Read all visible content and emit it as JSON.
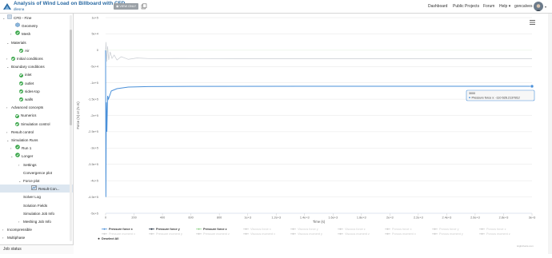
{
  "header": {
    "project_title": "Analysis of Wind Load on Billboard with CFD",
    "owner": "dlesna",
    "view_only": "VIEW ONLY",
    "nav": [
      "Dashboard",
      "Public Projects",
      "Forum",
      "Help",
      "goncalves"
    ]
  },
  "sidebar": {
    "items": [
      {
        "label": "CFD - Fine",
        "indent": 0,
        "chev": "⌄",
        "icon": "cfd-icon"
      },
      {
        "label": "Geometry",
        "indent": 2,
        "chev": "",
        "icon": "geometry-icon"
      },
      {
        "label": "Mesh",
        "indent": 2,
        "chev": "›",
        "icon": "mesh-icon"
      },
      {
        "label": "Materials",
        "indent": 1,
        "chev": "⌄",
        "icon": ""
      },
      {
        "label": "Air",
        "indent": 3,
        "chev": "",
        "icon": "check-icon"
      },
      {
        "label": "Initial conditions",
        "indent": 1,
        "chev": "›",
        "icon": "check-icon"
      },
      {
        "label": "Boundary conditions",
        "indent": 1,
        "chev": "⌄",
        "icon": ""
      },
      {
        "label": "inlet",
        "indent": 3,
        "chev": "",
        "icon": "check-icon"
      },
      {
        "label": "outlet",
        "indent": 3,
        "chev": "",
        "icon": "check-icon"
      },
      {
        "label": "sides-top",
        "indent": 3,
        "chev": "",
        "icon": "check-icon"
      },
      {
        "label": "walls",
        "indent": 3,
        "chev": "",
        "icon": "check-icon"
      },
      {
        "label": "Advanced concepts",
        "indent": 1,
        "chev": "›",
        "icon": ""
      },
      {
        "label": "Numerics",
        "indent": 2,
        "chev": "",
        "icon": "check-icon"
      },
      {
        "label": "Simulation control",
        "indent": 2,
        "chev": "",
        "icon": "check-icon"
      },
      {
        "label": "Result control",
        "indent": 1,
        "chev": "›",
        "icon": ""
      },
      {
        "label": "Simulation Runs",
        "indent": 1,
        "chev": "⌄",
        "icon": ""
      },
      {
        "label": "Run 1",
        "indent": 2,
        "chev": "›",
        "icon": "run-icon"
      },
      {
        "label": "Longer",
        "indent": 2,
        "chev": "⌄",
        "icon": "run-icon"
      },
      {
        "label": "Settings",
        "indent": 4,
        "chev": "›",
        "icon": ""
      },
      {
        "label": "Convergence plot",
        "indent": 4,
        "chev": "",
        "icon": ""
      },
      {
        "label": "Force plot",
        "indent": 4,
        "chev": "⌄",
        "icon": ""
      },
      {
        "label": "Result Con...",
        "indent": 6,
        "chev": "",
        "icon": "result-icon"
      },
      {
        "label": "Solver Log",
        "indent": 4,
        "chev": "",
        "icon": ""
      },
      {
        "label": "Solution Fields",
        "indent": 4,
        "chev": "",
        "icon": ""
      },
      {
        "label": "Simulation Job Info",
        "indent": 4,
        "chev": "",
        "icon": ""
      },
      {
        "label": "Meshing Job Info",
        "indent": 4,
        "chev": "›",
        "icon": ""
      },
      {
        "label": "Incompressible",
        "indent": 0,
        "chev": "›",
        "icon": ""
      },
      {
        "label": "Multiphase",
        "indent": 0,
        "chev": "›",
        "icon": ""
      }
    ],
    "job_status": "Job status"
  },
  "chart_data": {
    "type": "line",
    "xlabel": "Time (s)",
    "ylabel": "Force (N) or (N.m)",
    "x_ticks": [
      "0",
      "200",
      "400",
      "600",
      "800",
      "1e+3",
      "1.2e+3",
      "1.4e+3",
      "1.6e+3",
      "1.8e+3",
      "2e+3",
      "2.2e+3",
      "2.4e+3",
      "2.6e+3",
      "2.8e+3",
      "3e+3"
    ],
    "y_ticks": [
      "1e+5",
      "5e+4",
      "0",
      "-5e+4",
      "-1e+5",
      "-1.5e+5",
      "-2e+5",
      "-2.5e+5",
      "-3e+5",
      "-3.5e+5",
      "-4e+5",
      "-4.5e+5",
      "-5e+5"
    ],
    "xlim": [
      0,
      3000
    ],
    "ylim": [
      -500000,
      100000
    ],
    "series": [
      {
        "name": "Pressure force x",
        "color": "#4a90d9",
        "final": -110626.2137812,
        "active": true
      },
      {
        "name": "Pressure force y",
        "color": "#1b2a3a",
        "final": 0,
        "active": true
      },
      {
        "name": "Pressure force z",
        "color": "#8fd18a",
        "final": 0,
        "active": true
      },
      {
        "name": "Viscous force x",
        "color": "#cccccc",
        "active": false
      },
      {
        "name": "Viscous force y",
        "color": "#cccccc",
        "active": false
      },
      {
        "name": "Viscous force z",
        "color": "#cccccc",
        "active": false
      },
      {
        "name": "Porous force x",
        "color": "#cccccc",
        "active": false
      },
      {
        "name": "Porous force y",
        "color": "#cccccc",
        "active": false
      },
      {
        "name": "Porous force z",
        "color": "#cccccc",
        "active": false
      },
      {
        "name": "Pressure moment x",
        "color": "#cccccc",
        "active": false
      },
      {
        "name": "Pressure moment y",
        "color": "#cccccc",
        "active": false
      },
      {
        "name": "Pressure moment z",
        "color": "#cccccc",
        "active": false
      },
      {
        "name": "Viscous moment x",
        "color": "#cccccc",
        "active": false
      },
      {
        "name": "Viscous moment y",
        "color": "#cccccc",
        "active": false
      },
      {
        "name": "Viscous moment z",
        "color": "#cccccc",
        "active": false
      },
      {
        "name": "Porous moment x",
        "color": "#cccccc",
        "active": false
      },
      {
        "name": "Porous moment y",
        "color": "#cccccc",
        "active": false
      },
      {
        "name": "Porous moment z",
        "color": "#cccccc",
        "active": false
      }
    ],
    "deselect_all": "Deselect All",
    "tooltip": {
      "x": "3000",
      "text": "Pressure force x: -110 626.2137812"
    }
  },
  "credit": "Highcharts.com",
  "colors": {
    "accent": "#2a6aa3",
    "line": "#4a90d9",
    "check": "#3aa64a"
  }
}
